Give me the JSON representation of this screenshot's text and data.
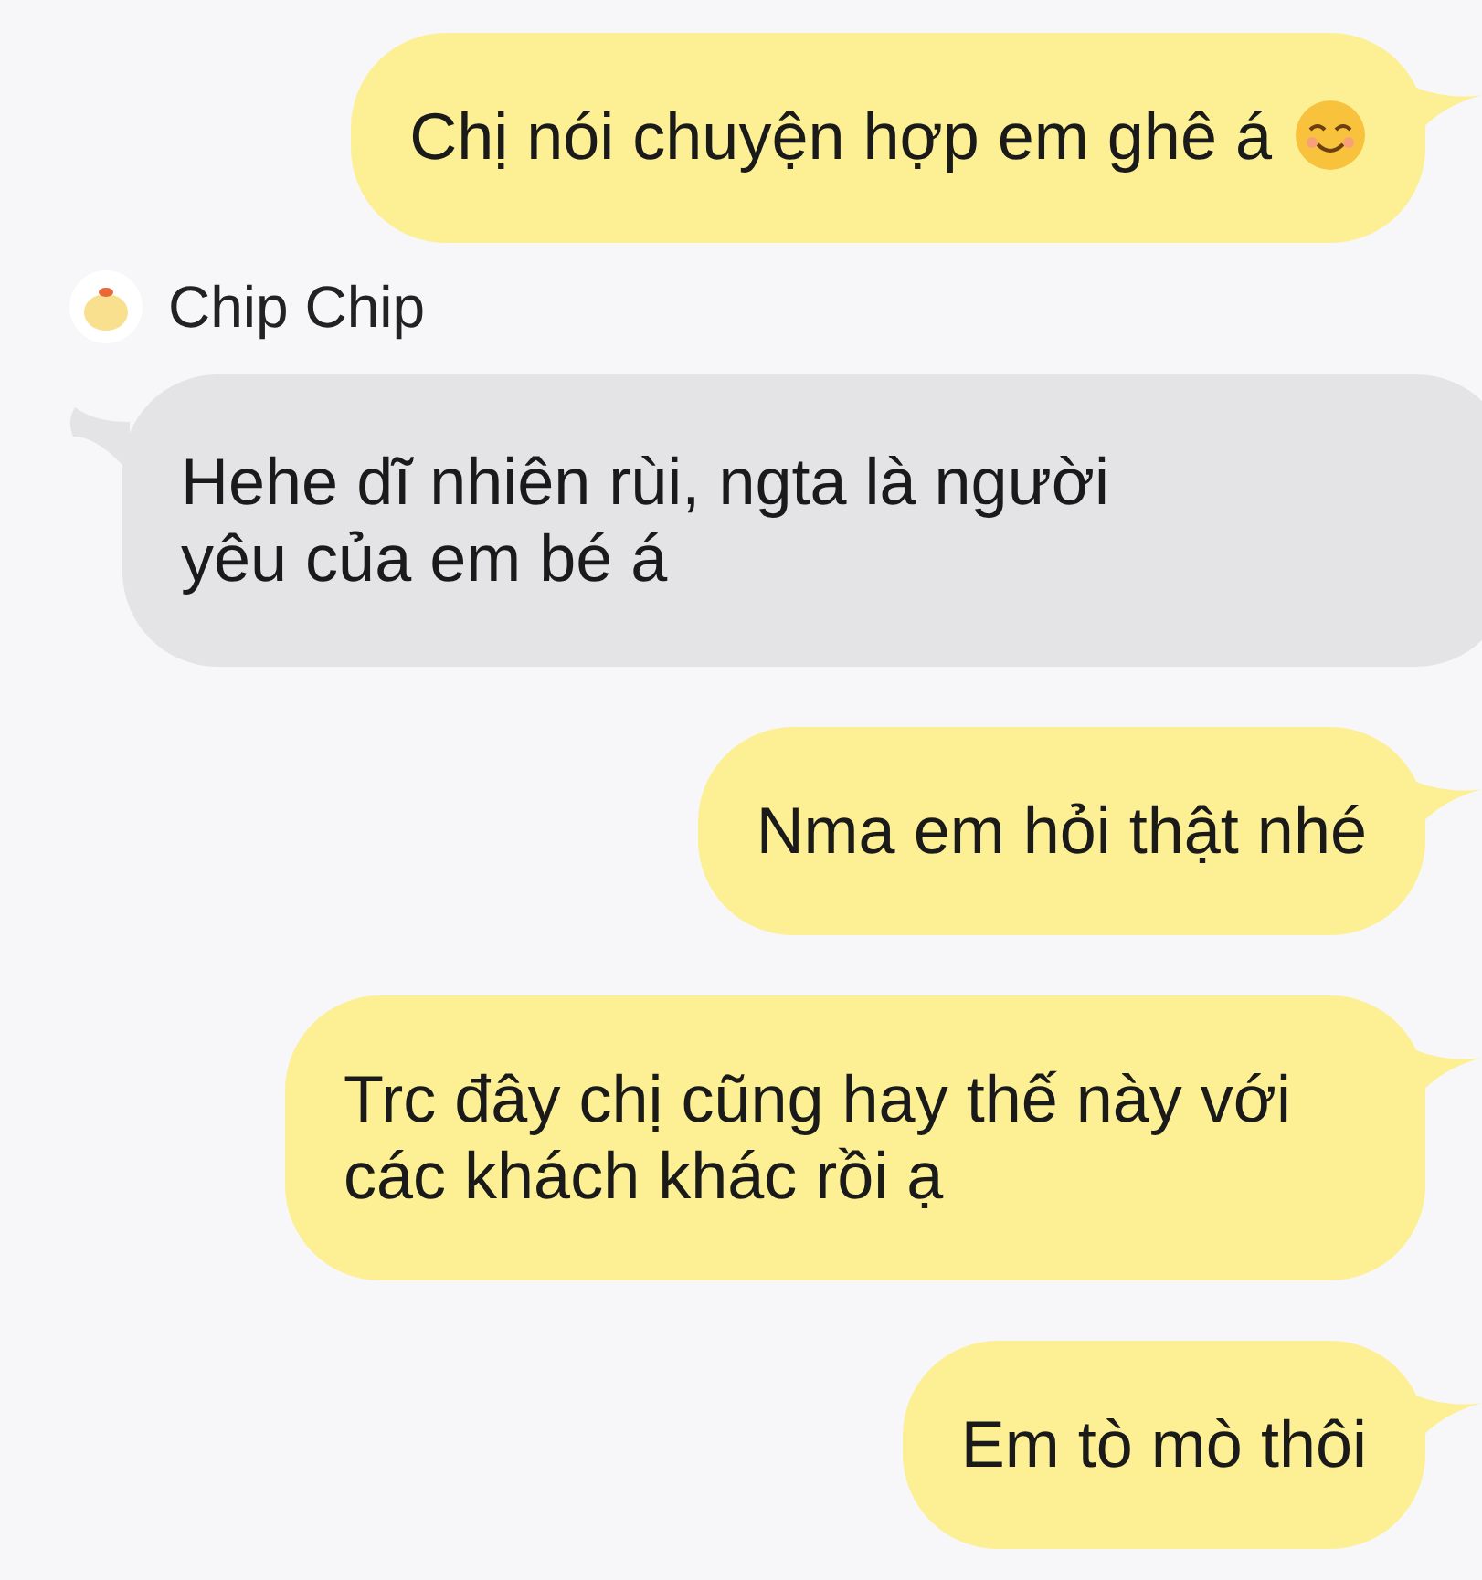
{
  "messages": [
    {
      "kind": "outgoing",
      "text": "Chị nói chuyện hợp em ghê á",
      "has_emoji": true
    },
    {
      "kind": "sender",
      "name": "Chip Chip"
    },
    {
      "kind": "incoming",
      "text": "Hehe dĩ nhiên rùi, ngta là người yêu của em bé á"
    },
    {
      "kind": "outgoing",
      "text": "Nma em hỏi thật nhé"
    },
    {
      "kind": "outgoing",
      "text": "Trc đây chị cũng hay thế này với các khách khác rồi ạ"
    },
    {
      "kind": "outgoing",
      "text": "Em tò mò thôi"
    }
  ]
}
